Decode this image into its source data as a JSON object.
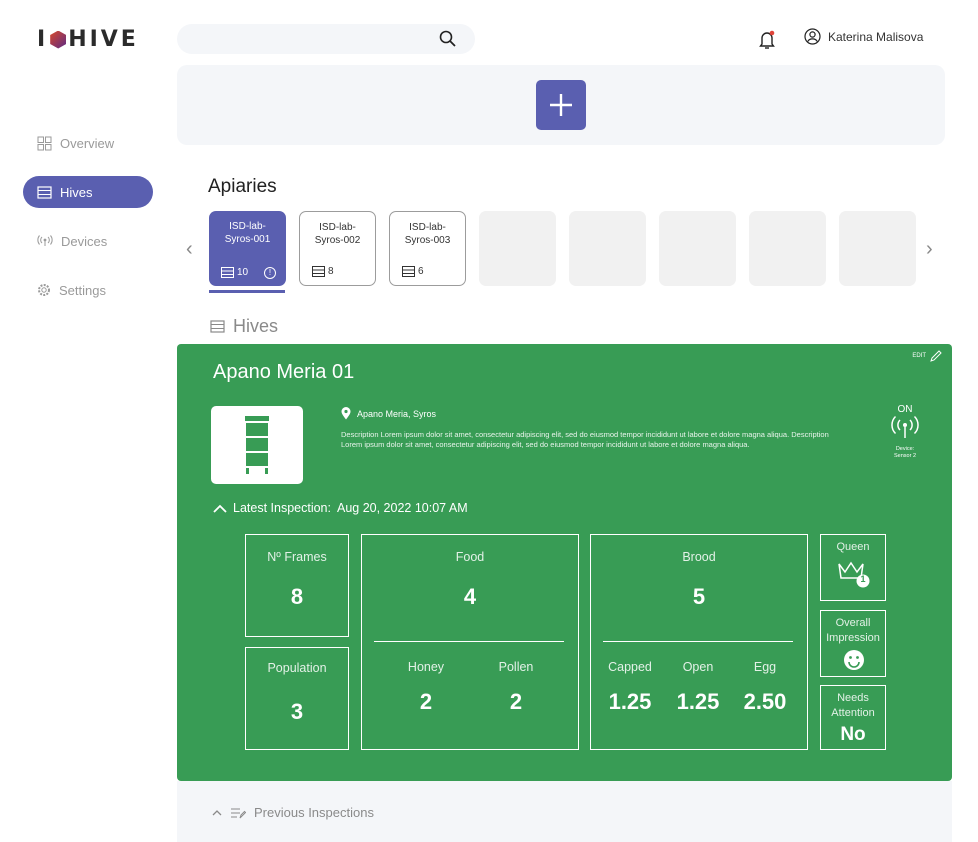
{
  "app": {
    "logo_text_left": "I",
    "logo_text_right": "HIVE"
  },
  "header": {
    "search": {
      "placeholder": ""
    },
    "user_name": "Katerina Malisova"
  },
  "sidebar": {
    "items": [
      {
        "label": "Overview",
        "icon": "grid-icon",
        "active": false
      },
      {
        "label": "Hives",
        "icon": "hive-icon",
        "active": true
      },
      {
        "label": "Devices",
        "icon": "antenna-icon",
        "active": false
      },
      {
        "label": "Settings",
        "icon": "gear-icon",
        "active": false
      }
    ]
  },
  "apiaries": {
    "title": "Apiaries",
    "cards": [
      {
        "name": "ISD-lab-Syros-001",
        "count": "10"
      },
      {
        "name": "ISD-lab-Syros-002",
        "count": "8"
      },
      {
        "name": "ISD-lab-Syros-003",
        "count": "6"
      }
    ]
  },
  "hives_section": {
    "title": "Hives"
  },
  "hive": {
    "name": "Apano Meria 01",
    "edit_label": "EDIT",
    "location": "Apano Meria, Syros",
    "description": "Description Lorem ipsum dolor sit amet, consectetur adipiscing elit, sed do eiusmod tempor incididunt ut labore et dolore magna aliqua. Description Lorem ipsum dolor sit amet, consectetur adipiscing elit, sed do eiusmod tempor incididunt ut labore et dolore magna aliqua.",
    "status": "ON",
    "device_label": "Device:",
    "device_name": "Sensor 2",
    "latest_label": "Latest Inspection:",
    "latest_date": "Aug 20, 2022 10:07 AM",
    "frames": {
      "label": "Nº Frames",
      "value": "8"
    },
    "population": {
      "label": "Population",
      "value": "3"
    },
    "food": {
      "label": "Food",
      "value": "4",
      "honey_label": "Honey",
      "honey": "2",
      "pollen_label": "Pollen",
      "pollen": "2"
    },
    "brood": {
      "label": "Brood",
      "value": "5",
      "capped_label": "Capped",
      "capped": "1.25",
      "open_label": "Open",
      "open": "1.25",
      "egg_label": "Egg",
      "egg": "2.50"
    },
    "queen": {
      "label": "Queen",
      "badge": "1"
    },
    "impression": {
      "label": "Overall Impression"
    },
    "attention": {
      "label": "Needs Attention",
      "value": "No"
    }
  },
  "previous": {
    "label": "Previous Inspections"
  },
  "colors": {
    "accent": "#5a5fb0",
    "card_green": "#389c55"
  }
}
